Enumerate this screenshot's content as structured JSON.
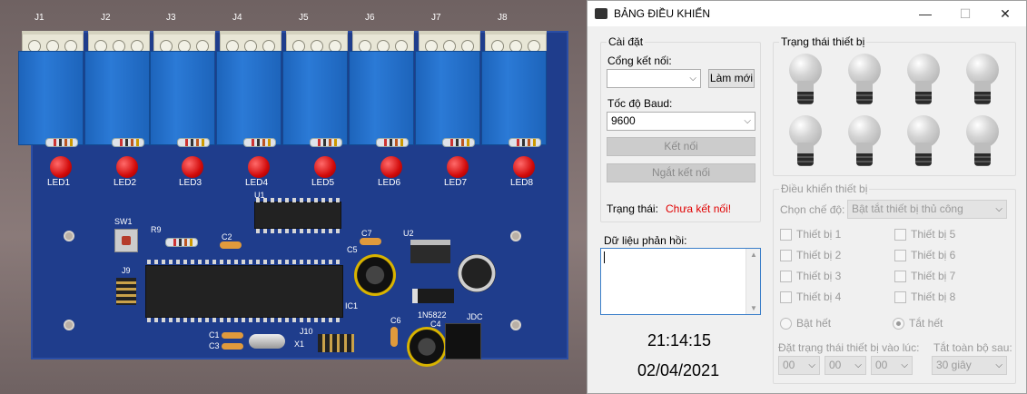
{
  "pcb": {
    "terminals": [
      "J1",
      "J2",
      "J3",
      "J4",
      "J5",
      "J6",
      "J7",
      "J8"
    ],
    "leds": [
      "LED1",
      "LED2",
      "LED3",
      "LED4",
      "LED5",
      "LED6",
      "LED7",
      "LED8"
    ],
    "silkscreen": {
      "u1": "U1",
      "u2": "U2",
      "sw1": "SW1",
      "r9": "R9",
      "j9": "J9",
      "c2": "C2",
      "c7": "C7",
      "c5": "C5",
      "ic1": "IC1",
      "diode": "1N5822",
      "c6": "C6",
      "c4": "C4",
      "jdc": "JDC",
      "c1": "C1",
      "c3": "C3",
      "j10": "J10",
      "x1": "X1"
    }
  },
  "window": {
    "title": "BẢNG ĐIỀU KHIỂN",
    "minimize_glyph": "—",
    "maximize_glyph": "☐",
    "close_glyph": "✕"
  },
  "settings": {
    "group_label": "Cài đặt",
    "port_label": "Cổng kết nối:",
    "port_value": "",
    "refresh_button": "Làm mới",
    "baud_label": "Tốc độ Baud:",
    "baud_value": "9600",
    "connect_button": "Kết nối",
    "disconnect_button": "Ngắt kết nối",
    "status_label": "Trạng thái:",
    "status_value": "Chưa kết nối!",
    "status_color": "#e00000"
  },
  "response": {
    "label": "Dữ liệu phản hồi:",
    "value": ""
  },
  "clock": {
    "time": "21:14:15",
    "date": "02/04/2021"
  },
  "device_status": {
    "group_label": "Trạng thái thiết bị",
    "bulbs": [
      "off",
      "off",
      "off",
      "off",
      "off",
      "off",
      "off",
      "off"
    ]
  },
  "device_control": {
    "group_label": "Điều khiển thiết bị",
    "mode_label": "Chọn chế độ:",
    "mode_value": "Bật tắt thiết bị thủ công",
    "devices": [
      "Thiết bị 1",
      "Thiết bị 2",
      "Thiết bị 3",
      "Thiết bị 4",
      "Thiết bị 5",
      "Thiết bị 6",
      "Thiết bị 7",
      "Thiết bị 8"
    ],
    "all_on": "Bật hết",
    "all_off": "Tắt hết",
    "schedule_label": "Đặt trạng thái thiết bị vào lúc:",
    "hour": "00",
    "minute": "00",
    "second": "00",
    "auto_off_label": "Tắt toàn bộ sau:",
    "auto_off_value": "30 giây"
  }
}
